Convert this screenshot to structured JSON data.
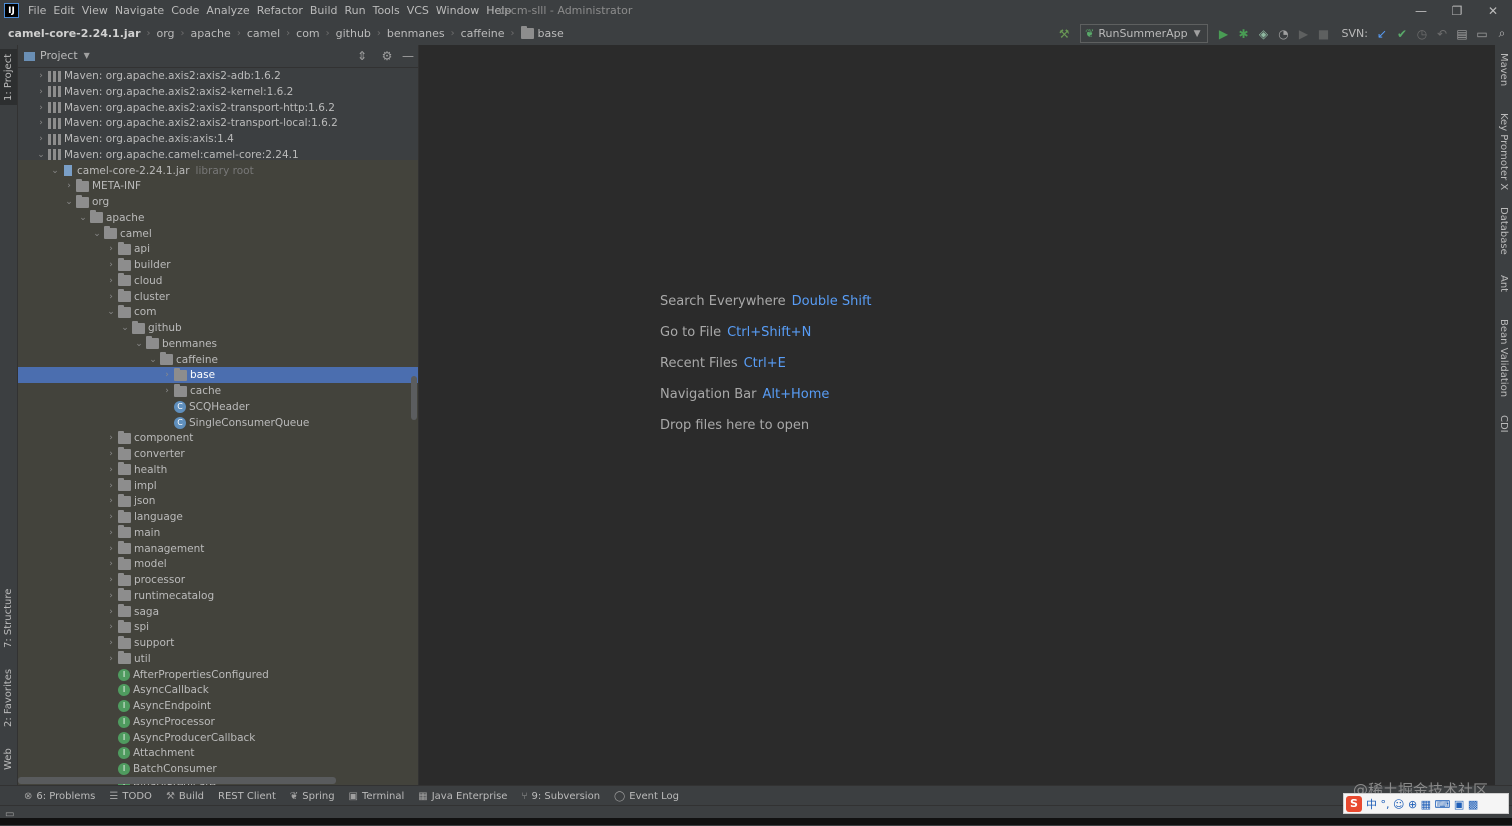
{
  "app": {
    "logo_text": "IJ",
    "window_title": "cscm-slll - Administrator",
    "window_controls": [
      "—",
      "❐",
      "✕"
    ]
  },
  "menu": [
    "File",
    "Edit",
    "View",
    "Navigate",
    "Code",
    "Analyze",
    "Refactor",
    "Build",
    "Run",
    "Tools",
    "VCS",
    "Window",
    "Help"
  ],
  "breadcrumb": [
    "camel-core-2.24.1.jar",
    "org",
    "apache",
    "camel",
    "com",
    "github",
    "benmanes",
    "caffeine",
    "base"
  ],
  "toolbar": {
    "run_config": "RunSummerApp",
    "svn_label": "SVN:",
    "colors": {
      "run": "#499c54",
      "build": "#6a9955",
      "svn_check": "#59a869"
    }
  },
  "left_stripe": {
    "project": "1: Project",
    "structure": "7: Structure",
    "favorites": "2: Favorites",
    "web": "Web"
  },
  "right_stripe": [
    "Maven",
    "Key Promoter X",
    "Database",
    "Ant",
    "Bean Validation",
    "CDI"
  ],
  "project_panel": {
    "title": "Project",
    "tree": [
      {
        "label": "Maven: org.apache.axis2:axis2-adb:1.6.2",
        "kind": "lib",
        "arrow": "›"
      },
      {
        "label": "Maven: org.apache.axis2:axis2-kernel:1.6.2",
        "kind": "lib",
        "arrow": "›"
      },
      {
        "label": "Maven: org.apache.axis2:axis2-transport-http:1.6.2",
        "kind": "lib",
        "arrow": "›"
      },
      {
        "label": "Maven: org.apache.axis2:axis2-transport-local:1.6.2",
        "kind": "lib",
        "arrow": "›"
      },
      {
        "label": "Maven: org.apache.axis:axis:1.4",
        "kind": "lib",
        "arrow": "›"
      },
      {
        "label": "Maven: org.apache.camel:camel-core:2.24.1",
        "kind": "lib",
        "arrow": "⌄"
      },
      {
        "label": "camel-core-2.24.1.jar",
        "kind": "jar",
        "arrow": "⌄",
        "suffix": "library root"
      },
      {
        "label": "META-INF",
        "kind": "folder",
        "arrow": "›"
      },
      {
        "label": "org",
        "kind": "folder",
        "arrow": "⌄"
      },
      {
        "label": "apache",
        "kind": "folder",
        "arrow": "⌄"
      },
      {
        "label": "camel",
        "kind": "folder",
        "arrow": "⌄"
      },
      {
        "label": "api",
        "kind": "folder",
        "arrow": "›"
      },
      {
        "label": "builder",
        "kind": "folder",
        "arrow": "›"
      },
      {
        "label": "cloud",
        "kind": "folder",
        "arrow": "›"
      },
      {
        "label": "cluster",
        "kind": "folder",
        "arrow": "›"
      },
      {
        "label": "com",
        "kind": "folder",
        "arrow": "⌄"
      },
      {
        "label": "github",
        "kind": "folder",
        "arrow": "⌄"
      },
      {
        "label": "benmanes",
        "kind": "folder",
        "arrow": "⌄"
      },
      {
        "label": "caffeine",
        "kind": "folder",
        "arrow": "⌄"
      },
      {
        "label": "base",
        "kind": "folder",
        "arrow": "›",
        "selected": true
      },
      {
        "label": "cache",
        "kind": "folder",
        "arrow": "›"
      },
      {
        "label": "SCQHeader",
        "kind": "abs-class",
        "arrow": ""
      },
      {
        "label": "SingleConsumerQueue",
        "kind": "abs-class",
        "arrow": ""
      },
      {
        "label": "component",
        "kind": "folder",
        "arrow": "›"
      },
      {
        "label": "converter",
        "kind": "folder",
        "arrow": "›"
      },
      {
        "label": "health",
        "kind": "folder",
        "arrow": "›"
      },
      {
        "label": "impl",
        "kind": "folder",
        "arrow": "›"
      },
      {
        "label": "json",
        "kind": "folder",
        "arrow": "›"
      },
      {
        "label": "language",
        "kind": "folder",
        "arrow": "›"
      },
      {
        "label": "main",
        "kind": "folder",
        "arrow": "›"
      },
      {
        "label": "management",
        "kind": "folder",
        "arrow": "›"
      },
      {
        "label": "model",
        "kind": "folder",
        "arrow": "›"
      },
      {
        "label": "processor",
        "kind": "folder",
        "arrow": "›"
      },
      {
        "label": "runtimecatalog",
        "kind": "folder",
        "arrow": "›"
      },
      {
        "label": "saga",
        "kind": "folder",
        "arrow": "›"
      },
      {
        "label": "spi",
        "kind": "folder",
        "arrow": "›"
      },
      {
        "label": "support",
        "kind": "folder",
        "arrow": "›"
      },
      {
        "label": "util",
        "kind": "folder",
        "arrow": "›"
      },
      {
        "label": "AfterPropertiesConfigured",
        "kind": "interface",
        "arrow": ""
      },
      {
        "label": "AsyncCallback",
        "kind": "interface",
        "arrow": ""
      },
      {
        "label": "AsyncEndpoint",
        "kind": "interface",
        "arrow": ""
      },
      {
        "label": "AsyncProcessor",
        "kind": "interface",
        "arrow": ""
      },
      {
        "label": "AsyncProducerCallback",
        "kind": "interface",
        "arrow": ""
      },
      {
        "label": "Attachment",
        "kind": "interface",
        "arrow": ""
      },
      {
        "label": "BatchConsumer",
        "kind": "interface",
        "arrow": ""
      },
      {
        "label": "BinaryPredicate",
        "kind": "interface",
        "arrow": ""
      }
    ]
  },
  "editor": {
    "hints": [
      {
        "text": "Search Everywhere",
        "key": "Double Shift"
      },
      {
        "text": "Go to File",
        "key": "Ctrl+Shift+N"
      },
      {
        "text": "Recent Files",
        "key": "Ctrl+E"
      },
      {
        "text": "Navigation Bar",
        "key": "Alt+Home"
      },
      {
        "text": "Drop files here to open",
        "key": ""
      }
    ]
  },
  "bottom_tools": [
    {
      "label": "6: Problems",
      "icon": "⊗"
    },
    {
      "label": "TODO",
      "icon": "☰"
    },
    {
      "label": "Build",
      "icon": "⚒"
    },
    {
      "label": "REST Client",
      "icon": ""
    },
    {
      "label": "Spring",
      "icon": "❦"
    },
    {
      "label": "Terminal",
      "icon": "▣"
    },
    {
      "label": "Java Enterprise",
      "icon": "▦"
    },
    {
      "label": "9: Subversion",
      "icon": "⑂"
    },
    {
      "label": "Event Log",
      "icon": "◯"
    }
  ],
  "watermark": "@稀土掘金技术社区",
  "ime": {
    "logo": "S",
    "text": "中 °, ☺ ⊕ ▦ ⌨ ▣ ▩"
  }
}
